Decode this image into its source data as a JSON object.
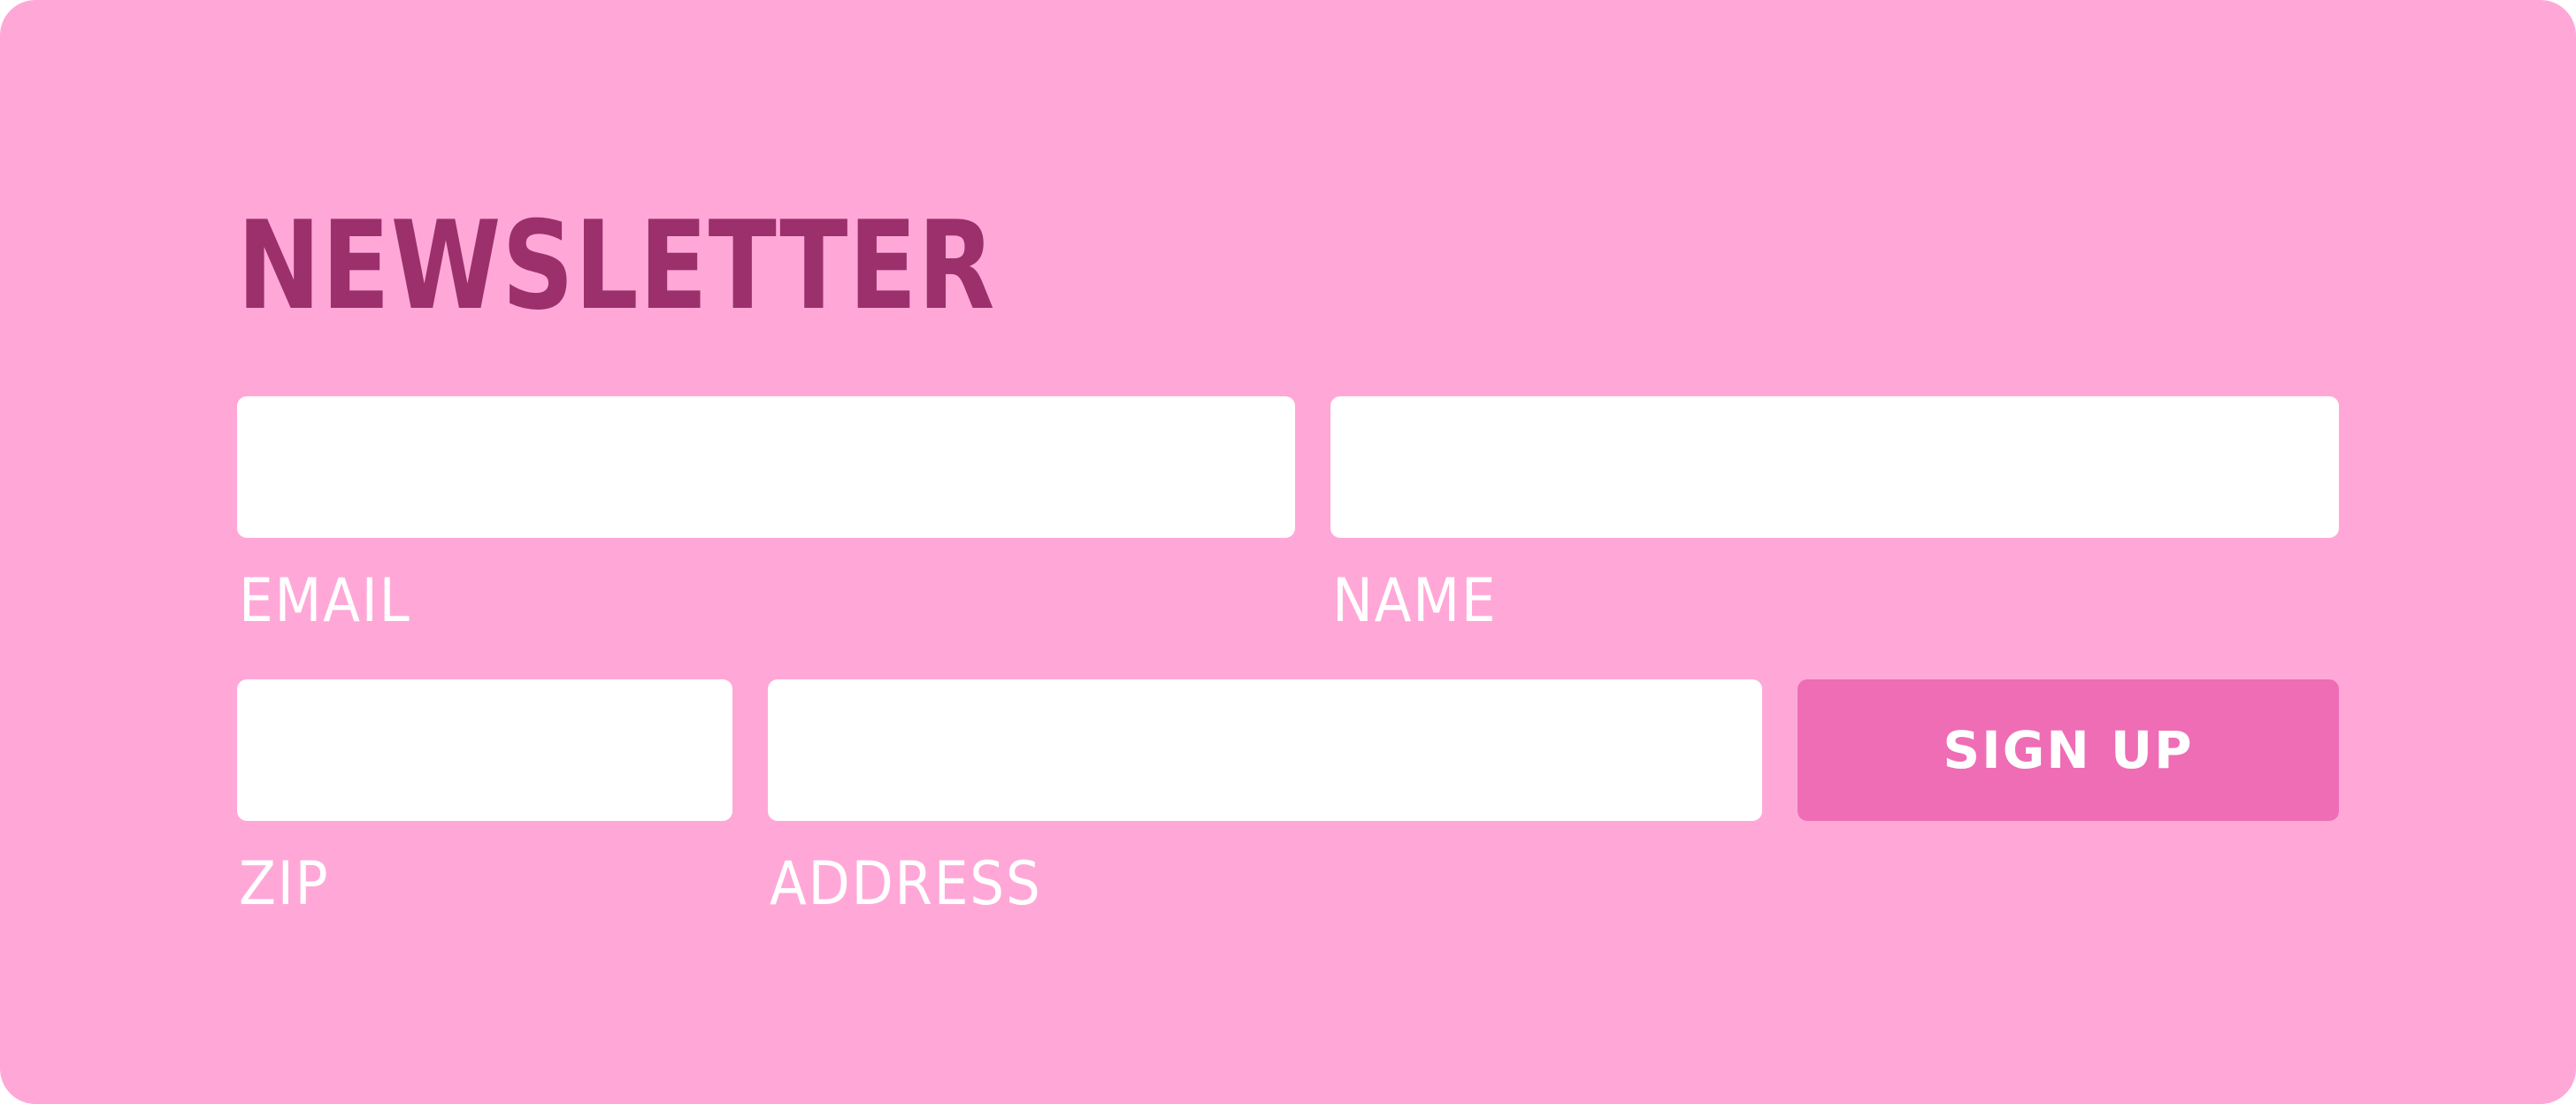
{
  "form": {
    "title": "NEWSLETTER",
    "email": {
      "label": "EMAIL",
      "value": "",
      "placeholder": ""
    },
    "name": {
      "label": "NAME",
      "value": "",
      "placeholder": ""
    },
    "zip": {
      "label": "ZIP",
      "value": "",
      "placeholder": ""
    },
    "address": {
      "label": "ADDRESS",
      "value": "",
      "placeholder": ""
    },
    "submit_label": "SIGN UP"
  },
  "colors": {
    "background": "#ffa8d8",
    "title": "#9c306c",
    "button": "#ee6db5",
    "field": "#ffffff",
    "label": "#ffffff"
  }
}
